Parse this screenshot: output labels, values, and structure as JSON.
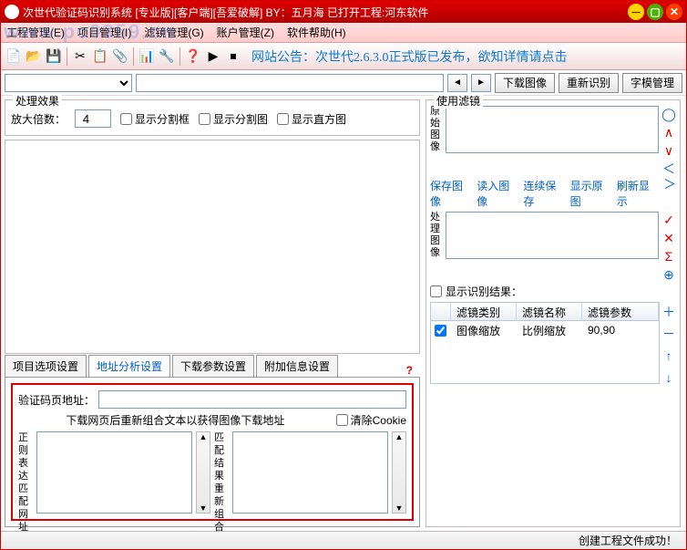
{
  "window": {
    "title": "次世代验证码识别系统 [专业版][客户端][吾爱破解]  BY：五月海 已打开工程:河东软件"
  },
  "menu": {
    "items": [
      "工程管理(E)",
      "项目管理(I)",
      "滤镜管理(G)",
      "账户管理(Z)",
      "软件帮助(H)"
    ]
  },
  "announcement": "网站公告：次世代2.6.3.0正式版已发布，欲知详情请点击",
  "nav_buttons": {
    "download_image": "下载图像",
    "rerecognize": "重新识别",
    "font_template": "字模管理"
  },
  "effect": {
    "group_title": "处理效果",
    "zoom_label": "放大倍数：",
    "zoom_value": "4",
    "cb_split_box": "显示分割框",
    "cb_split_img": "显示分割图",
    "cb_histogram": "显示直方图"
  },
  "tabs": {
    "items": [
      "项目选项设置",
      "地址分析设置",
      "下载参数设置",
      "附加信息设置"
    ],
    "help": "?"
  },
  "addr_form": {
    "url_label": "验证码页地址：",
    "hint": "下载网页后重新组合文本以获得图像下载地址",
    "clear_cookie": "清除Cookie",
    "regex_label": "正则表达匹配网址",
    "recomb_label": "匹配结果重新组合"
  },
  "filter_panel": {
    "group_title": "使用滤镜",
    "orig_label": "原始图像",
    "proc_label": "处理图像",
    "links": [
      "保存图像",
      "读入图像",
      "连续保存",
      "显示原图",
      "刷新显示"
    ],
    "show_result": "显示识别结果：",
    "table": {
      "headers": [
        "",
        "滤镜类别",
        "滤镜名称",
        "滤镜参数"
      ],
      "rows": [
        {
          "checked": true,
          "category": "图像缩放",
          "name": "比例缩放",
          "params": "90,90"
        }
      ]
    }
  },
  "status": "创建工程文件成功！",
  "side_icons1": [
    "◯",
    "∧",
    "∨",
    "＜",
    "＞",
    "✓",
    "✕",
    "Σ",
    "⊕"
  ],
  "side_icons2": [
    "＋",
    "－",
    "↑",
    "↓"
  ],
  "watermark": "www.pc0359.cn"
}
